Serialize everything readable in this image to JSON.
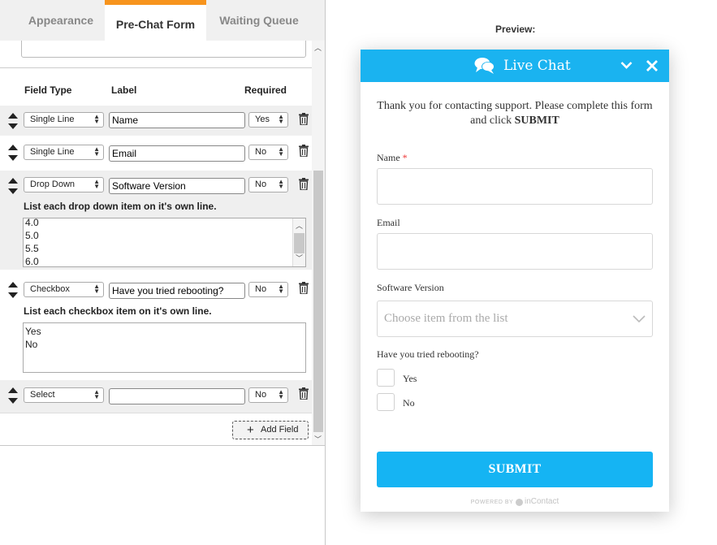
{
  "tabs": [
    {
      "label": "Appearance"
    },
    {
      "label": "Pre-Chat Form"
    },
    {
      "label": "Waiting Queue"
    }
  ],
  "columns": {
    "field_type": "Field Type",
    "label": "Label",
    "required": "Required"
  },
  "fields": [
    {
      "type": "Single Line",
      "label": "Name",
      "required": "Yes"
    },
    {
      "type": "Single Line",
      "label": "Email",
      "required": "No"
    },
    {
      "type": "Drop Down",
      "label": "Software Version",
      "required": "No",
      "hint": "List each drop down item on it's own line.",
      "items": [
        "4.0",
        "5.0",
        "5.5",
        "6.0"
      ]
    },
    {
      "type": "Checkbox",
      "label": "Have you tried rebooting?",
      "required": "No",
      "hint": "List each checkbox item on it's own line.",
      "items": [
        "Yes",
        "No"
      ]
    },
    {
      "type": "Select",
      "label": "",
      "required": "No"
    }
  ],
  "add_field_label": "Add Field",
  "preview": {
    "label": "Preview:",
    "header_title": "Live Chat",
    "intro_text": "Thank you for contacting support. Please complete this form and click ",
    "intro_bold": "SUBMIT",
    "name_label": "Name",
    "required_mark": "*",
    "email_label": "Email",
    "version_label": "Software Version",
    "version_placeholder": "Choose item from the list",
    "reboot_label": "Have you tried rebooting?",
    "reboot_options": [
      "Yes",
      "No"
    ],
    "submit_label": "SUBMIT",
    "powered_by": "POWERED BY",
    "powered_brand": "inContact"
  },
  "colors": {
    "accent_orange": "#f7941d",
    "header_blue": "#1ab3f0",
    "submit_blue": "#15b4f3",
    "required_red": "#ee3333"
  }
}
